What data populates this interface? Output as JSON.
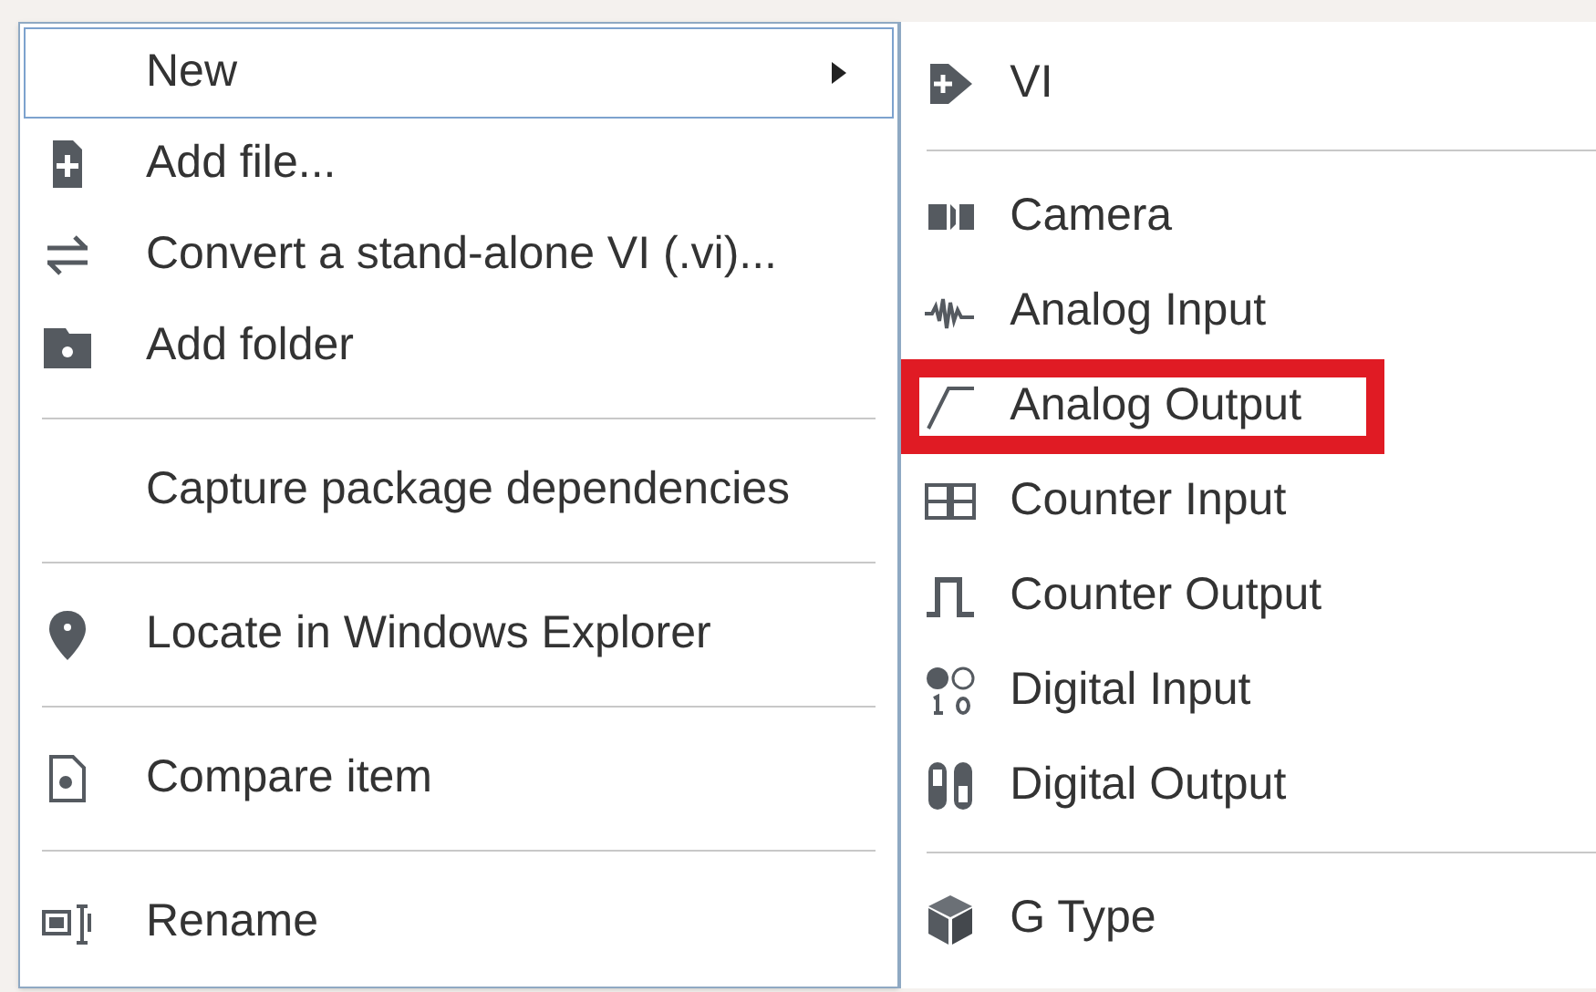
{
  "menu": {
    "items": [
      {
        "kind": "item",
        "label": "New",
        "selected": true,
        "submenu": true
      },
      {
        "kind": "item",
        "label": "Add file...",
        "selected": false,
        "submenu": false
      },
      {
        "kind": "item",
        "label": "Convert a stand-alone VI (.vi)...",
        "selected": false,
        "submenu": false
      },
      {
        "kind": "item",
        "label": "Add folder",
        "selected": false,
        "submenu": false
      },
      {
        "kind": "separator"
      },
      {
        "kind": "item",
        "label": "Capture package dependencies",
        "selected": false,
        "submenu": false
      },
      {
        "kind": "separator"
      },
      {
        "kind": "item",
        "label": "Locate in Windows Explorer",
        "selected": false,
        "submenu": false
      },
      {
        "kind": "separator"
      },
      {
        "kind": "item",
        "label": "Compare item",
        "selected": false,
        "submenu": false
      },
      {
        "kind": "separator"
      },
      {
        "kind": "item",
        "label": "Rename",
        "selected": false,
        "submenu": false
      }
    ]
  },
  "submenu": {
    "items": [
      {
        "kind": "item",
        "label": "VI",
        "annotated": false
      },
      {
        "kind": "separator"
      },
      {
        "kind": "item",
        "label": "Camera",
        "annotated": false
      },
      {
        "kind": "item",
        "label": "Analog Input",
        "annotated": false
      },
      {
        "kind": "item",
        "label": "Analog Output",
        "annotated": true
      },
      {
        "kind": "item",
        "label": "Counter Input",
        "annotated": false
      },
      {
        "kind": "item",
        "label": "Counter Output",
        "annotated": false
      },
      {
        "kind": "item",
        "label": "Digital Input",
        "annotated": false
      },
      {
        "kind": "item",
        "label": "Digital Output",
        "annotated": false
      },
      {
        "kind": "separator"
      },
      {
        "kind": "item",
        "label": "G Type",
        "annotated": false
      }
    ]
  }
}
